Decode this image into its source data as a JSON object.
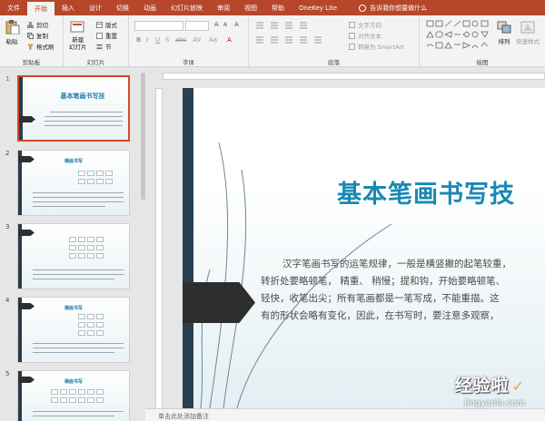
{
  "tabs": [
    {
      "label": "文件"
    },
    {
      "label": "开始"
    },
    {
      "label": "插入"
    },
    {
      "label": "设计"
    },
    {
      "label": "切换"
    },
    {
      "label": "动画"
    },
    {
      "label": "幻灯片放映"
    },
    {
      "label": "审阅"
    },
    {
      "label": "视图"
    },
    {
      "label": "帮助"
    },
    {
      "label": "OneKey Lite"
    }
  ],
  "tell_me": "告诉我你想要做什么",
  "ribbon": {
    "clipboard": {
      "paste": "粘贴",
      "cut": "剪切",
      "copy": "复制",
      "format_painter": "格式刷",
      "label": "剪贴板"
    },
    "slides": {
      "new_slide": "新建\n幻灯片",
      "layout": "版式",
      "reset": "重置",
      "section": "节",
      "label": "幻灯片"
    },
    "font": {
      "label": "字体"
    },
    "paragraph": {
      "text_direction": "文字方向",
      "align_text": "对齐文本",
      "smartart": "转换为 SmartArt",
      "label": "段落"
    },
    "drawing": {
      "arrange": "排列",
      "quick_styles": "快速样式",
      "label": "绘图"
    }
  },
  "slides": [
    {
      "num": "1",
      "title": "基本笔画书写技"
    },
    {
      "num": "2",
      "title": "横画书写"
    },
    {
      "num": "3",
      "title": ""
    },
    {
      "num": "4",
      "title": "横画书写"
    },
    {
      "num": "5",
      "title": "横画书写"
    }
  ],
  "main_slide": {
    "title": "基本笔画书写技",
    "body": [
      "汉字笔画书写的运笔规律，一般是横竖撇的起笔较重，",
      "转折处要略顿笔，  精重、 稍慢；提和钩，开始要略顿笔、",
      "轻快，收笔出尖；所有笔画都是一笔写成，不能重描。这",
      "有的形状会略有变化，因此，在书写时，要注意多观察，"
    ]
  },
  "status": {
    "notes_placeholder": "单击此处添加备注"
  },
  "watermark": {
    "line1": "经验啦",
    "line2": "jingyanla.com"
  },
  "colors": {
    "accent": "#b7472a",
    "title_blue": "#1a88b3"
  }
}
